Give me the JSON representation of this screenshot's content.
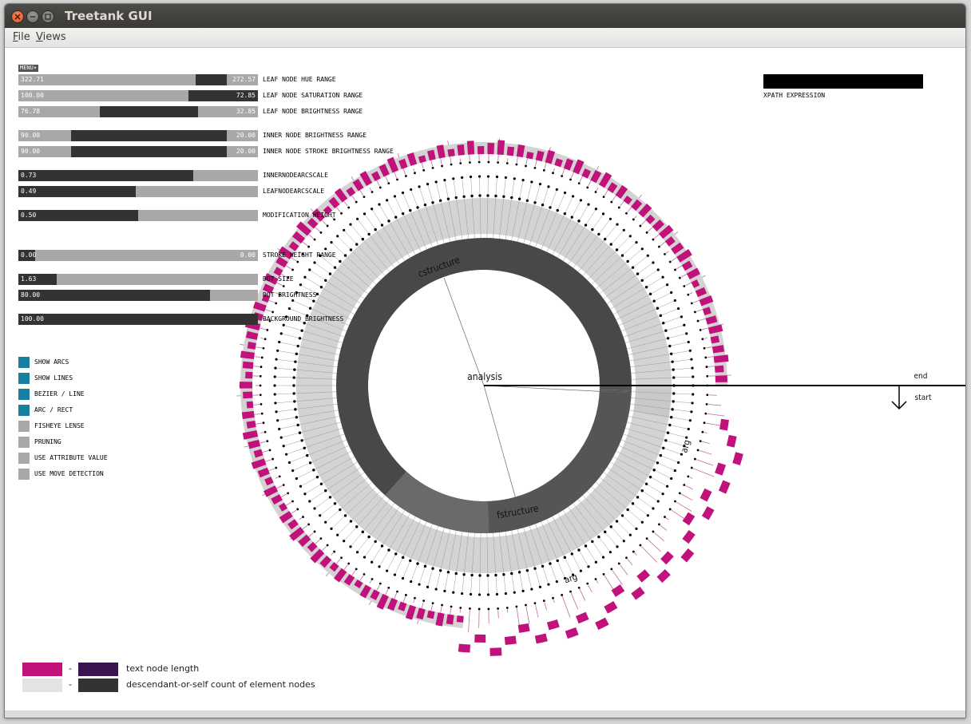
{
  "window": {
    "title": "Treetank GUI"
  },
  "menubar": {
    "items": [
      "File",
      "Views"
    ]
  },
  "controls": {
    "menu_label": "MENU",
    "sliders": [
      {
        "label": "LEAF NODE HUE RANGE",
        "left_value": "322.71",
        "right_value": "272.57",
        "range": [
          0.74,
          0.87
        ]
      },
      {
        "label": "LEAF NODE SATURATION RANGE",
        "left_value": "100.00",
        "right_value": "72.85",
        "range": [
          0.71,
          1.0
        ]
      },
      {
        "label": "LEAF NODE BRIGHTNESS RANGE",
        "left_value": "76.78",
        "right_value": "32.85",
        "range": [
          0.34,
          0.75
        ]
      },
      {
        "label": "INNER NODE BRIGHTNESS RANGE",
        "left_value": "90.00",
        "right_value": "20.00",
        "range": [
          0.22,
          0.87
        ]
      },
      {
        "label": "INNER NODE STROKE BRIGHTNESS RANGE",
        "left_value": "90.00",
        "right_value": "20.00",
        "range": [
          0.22,
          0.87
        ]
      },
      {
        "label": "INNERNODEARCSCALE",
        "left_value": "0.73",
        "right_value": "",
        "range": [
          0.0,
          0.73
        ]
      },
      {
        "label": "LEAFNODEARCSCALE",
        "left_value": "0.49",
        "right_value": "",
        "range": [
          0.0,
          0.49
        ]
      },
      {
        "label": "MODIFICATION WEIGHT",
        "left_value": "0.50",
        "right_value": "",
        "range": [
          0.0,
          0.5
        ]
      },
      {
        "label": "STROKE WEIGHT RANGE",
        "left_value": "0.00",
        "right_value": "0.00",
        "range": [
          0.0,
          0.07
        ]
      },
      {
        "label": "DOT SIZE",
        "left_value": "1.63",
        "right_value": "",
        "range": [
          0.0,
          0.16
        ]
      },
      {
        "label": "DOT BRIGHTNESS",
        "left_value": "80.00",
        "right_value": "",
        "range": [
          0.0,
          0.8
        ]
      },
      {
        "label": "BACKGROUND BRIGHTNESS",
        "left_value": "100.00",
        "right_value": "",
        "range": [
          0.0,
          1.0
        ]
      }
    ],
    "toggles": [
      {
        "label": "SHOW ARCS",
        "on": true
      },
      {
        "label": "SHOW LINES",
        "on": true
      },
      {
        "label": "BEZIER / LINE",
        "on": true
      },
      {
        "label": "ARC / RECT",
        "on": true
      },
      {
        "label": "FISHEYE LENSE",
        "on": false
      },
      {
        "label": "PRUNING",
        "on": false
      },
      {
        "label": "USE ATTRIBUTE VALUE",
        "on": false
      },
      {
        "label": "USE MOVE DETECTION",
        "on": false
      }
    ]
  },
  "xpath": {
    "label": "XPATH EXPRESSION",
    "value": ""
  },
  "visualization": {
    "root_label": "analysis",
    "node_labels": [
      "cstructure",
      "fstructure",
      "arg",
      "arg"
    ],
    "end_label": "end",
    "start_label": "start",
    "colors": {
      "leaf": "#c0127a",
      "inner_dark": "#5a5a5a",
      "inner_light": "#d9d9d9",
      "dot": "#000000"
    }
  },
  "legend": {
    "rows": [
      {
        "from_color": "#c0127a",
        "to_color": "#3a1450",
        "separator": "-",
        "text": "text node length"
      },
      {
        "from_color": "#e3e3e3",
        "to_color": "#333333",
        "separator": "-",
        "text": "descendant-or-self count of element nodes"
      }
    ]
  }
}
